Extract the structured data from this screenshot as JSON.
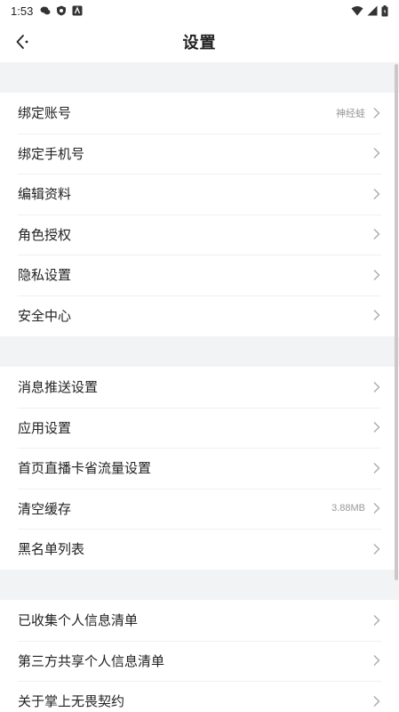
{
  "status_bar": {
    "time": "1:53",
    "icons_left": [
      "chat-icon",
      "shield-icon",
      "a-icon"
    ],
    "icons_right": [
      "wifi-icon",
      "signal-icon",
      "battery-icon"
    ]
  },
  "header": {
    "title": "设置",
    "back_icon": "back-arrow-icon"
  },
  "groups": [
    {
      "items": [
        {
          "label": "绑定账号",
          "value": "神经蛙"
        },
        {
          "label": "绑定手机号",
          "value": ""
        },
        {
          "label": "编辑资料",
          "value": ""
        },
        {
          "label": "角色授权",
          "value": ""
        },
        {
          "label": "隐私设置",
          "value": ""
        },
        {
          "label": "安全中心",
          "value": ""
        }
      ]
    },
    {
      "items": [
        {
          "label": "消息推送设置",
          "value": ""
        },
        {
          "label": "应用设置",
          "value": ""
        },
        {
          "label": "首页直播卡省流量设置",
          "value": ""
        },
        {
          "label": "清空缓存",
          "value": "3.88MB"
        },
        {
          "label": "黑名单列表",
          "value": ""
        }
      ]
    },
    {
      "items": [
        {
          "label": "已收集个人信息清单",
          "value": ""
        },
        {
          "label": "第三方共享个人信息清单",
          "value": ""
        },
        {
          "label": "关于掌上无畏契约",
          "value": ""
        }
      ]
    }
  ],
  "colors": {
    "background": "#ffffff",
    "section_gap": "#f2f3f5",
    "text": "#222222",
    "secondary_text": "#999999",
    "divider": "#f0f0f2"
  }
}
